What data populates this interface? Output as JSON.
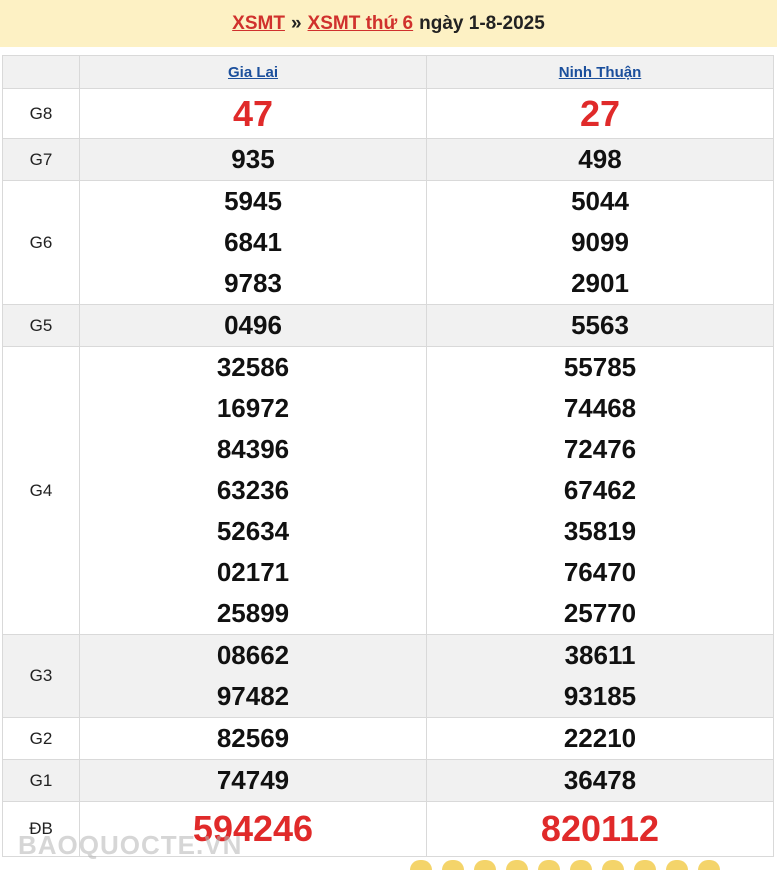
{
  "header": {
    "xsmt_link": "XSMT",
    "separator": "»",
    "day_link": "XSMT thứ 6",
    "date_text": "ngày 1-8-2025"
  },
  "provinces": [
    "Gia Lai",
    "Ninh Thuận"
  ],
  "rows": [
    {
      "label": "G8",
      "gia_lai": [
        "47"
      ],
      "ninh_thuan": [
        "27"
      ]
    },
    {
      "label": "G7",
      "gia_lai": [
        "935"
      ],
      "ninh_thuan": [
        "498"
      ]
    },
    {
      "label": "G6",
      "gia_lai": [
        "5945",
        "6841",
        "9783"
      ],
      "ninh_thuan": [
        "5044",
        "9099",
        "2901"
      ]
    },
    {
      "label": "G5",
      "gia_lai": [
        "0496"
      ],
      "ninh_thuan": [
        "5563"
      ]
    },
    {
      "label": "G4",
      "gia_lai": [
        "32586",
        "16972",
        "84396",
        "63236",
        "52634",
        "02171",
        "25899"
      ],
      "ninh_thuan": [
        "55785",
        "74468",
        "72476",
        "67462",
        "35819",
        "76470",
        "25770"
      ]
    },
    {
      "label": "G3",
      "gia_lai": [
        "08662",
        "97482"
      ],
      "ninh_thuan": [
        "38611",
        "93185"
      ]
    },
    {
      "label": "G2",
      "gia_lai": [
        "82569"
      ],
      "ninh_thuan": [
        "22210"
      ]
    },
    {
      "label": "G1",
      "gia_lai": [
        "74749"
      ],
      "ninh_thuan": [
        "36478"
      ]
    },
    {
      "label": "ĐB",
      "gia_lai": [
        "594246"
      ],
      "ninh_thuan": [
        "820112"
      ]
    }
  ],
  "watermark": "BAOQUOCTE.VN",
  "colors": {
    "header_bg": "#fdf1c4",
    "accent_red": "#e02a2a",
    "link_blue": "#1b4f9c",
    "alt_row": "#f1f1f1"
  }
}
